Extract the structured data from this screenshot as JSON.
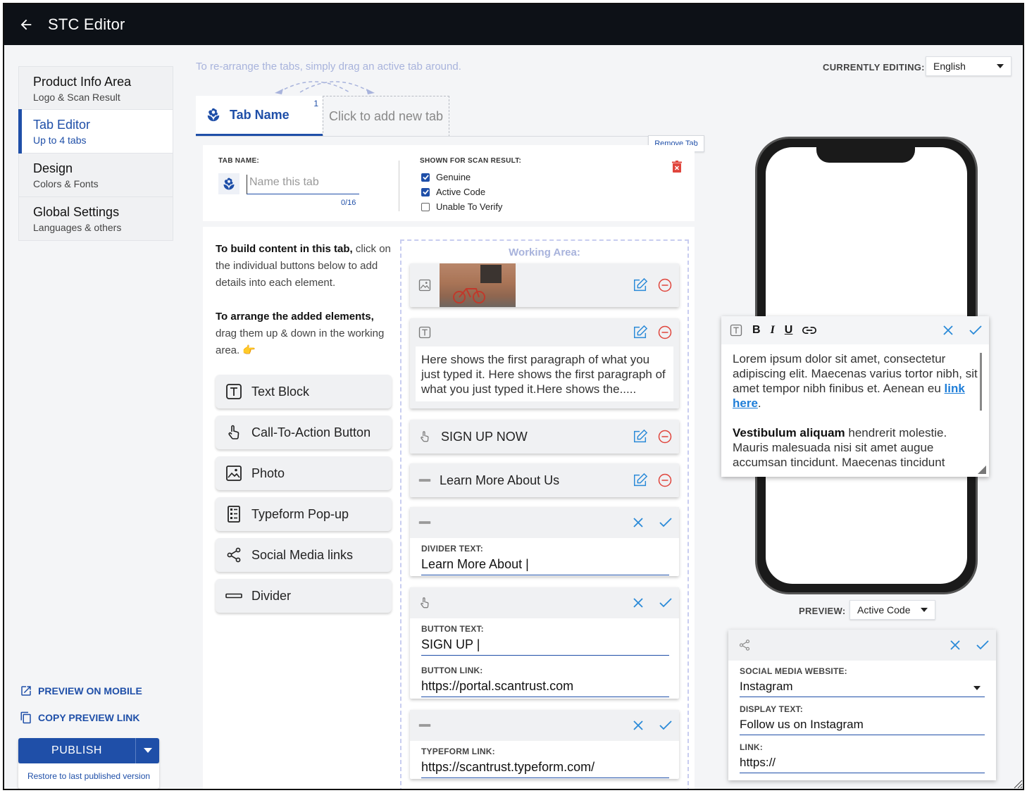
{
  "app": {
    "title": "STC Editor"
  },
  "sidebar": {
    "items": [
      {
        "title": "Product Info Area",
        "subtitle": "Logo & Scan Result"
      },
      {
        "title": "Tab Editor",
        "subtitle": "Up to 4 tabs"
      },
      {
        "title": "Design",
        "subtitle": "Colors & Fonts"
      },
      {
        "title": "Global Settings",
        "subtitle": "Languages & others"
      }
    ],
    "preview_mobile": "PREVIEW ON MOBILE",
    "copy_preview": "COPY PREVIEW LINK",
    "publish": "PUBLISH",
    "restore": "Restore to last published version"
  },
  "editor": {
    "hint": "To re-arrange the tabs, simply drag an active tab around.",
    "tab_active": {
      "label": "Tab Name",
      "index": "1"
    },
    "tab_new": "Click to add new tab",
    "remove_tab": "Remove Tab",
    "tab_name_label": "TAB NAME:",
    "tab_name_placeholder": "Name this tab",
    "tab_name_count": "0/16",
    "scan_label": "SHOWN FOR SCAN RESULT:",
    "scan_options": [
      {
        "label": "Genuine",
        "checked": true
      },
      {
        "label": "Active Code",
        "checked": true
      },
      {
        "label": "Unable To Verify",
        "checked": false
      }
    ],
    "instr1_bold": "To build content in this tab,",
    "instr1_rest": " click on the individual buttons below to add details into each element.",
    "instr2_bold": "To arrange the added elements,",
    "instr2_rest": " drag them up & down in the working area. 👉",
    "elements": [
      {
        "label": "Text Block",
        "icon": "text-icon"
      },
      {
        "label": "Call-To-Action Button",
        "icon": "pointer-icon"
      },
      {
        "label": "Photo",
        "icon": "photo-icon"
      },
      {
        "label": "Typeform Pop-up",
        "icon": "form-icon"
      },
      {
        "label": "Social Media links",
        "icon": "share-icon"
      },
      {
        "label": "Divider",
        "icon": "divider-icon"
      }
    ],
    "working_area": "Working Area:",
    "text_preview": "Here shows the first paragraph of what you just typed it. Here shows the first paragraph of what you just typed it.Here shows the.....",
    "cta_label": "SIGN UP NOW",
    "divider_label": "Learn More About Us",
    "divider_edit": {
      "label": "DIVIDER TEXT:",
      "value": "Learn More About |"
    },
    "button_edit": {
      "text_label": "BUTTON TEXT:",
      "text_value": "SIGN UP |",
      "link_label": "BUTTON LINK:",
      "link_value": "https://portal.scantrust.com"
    },
    "typeform_edit": {
      "label": "TYPEFORM LINK:",
      "value": "https://scantrust.typeform.com/"
    }
  },
  "right": {
    "currently_editing_label": "CURRENTLY EDITING:",
    "language": "English",
    "rte": {
      "p1": "Lorem ipsum dolor sit amet, consectetur adipiscing elit. Maecenas varius tortor nibh, sit amet tempor nibh finibus et. Aenean eu ",
      "link": "link here",
      "p1_end": ".",
      "p2_bold": "Vestibulum aliquam",
      "p2": " hendrerit molestie. Mauris malesuada nisi sit amet augue accumsan tincidunt. Maecenas tincidunt"
    },
    "preview_label": "PREVIEW:",
    "preview_value": "Active Code",
    "social": {
      "site_label": "SOCIAL MEDIA WEBSITE:",
      "site_value": "Instagram",
      "display_label": "DISPLAY TEXT:",
      "display_value": "Follow us on Instagram",
      "link_label": "LINK:",
      "link_value": "https://"
    }
  },
  "colors": {
    "accent": "#1f4fa8",
    "topbar": "#0d1117",
    "danger": "#e0453c"
  }
}
